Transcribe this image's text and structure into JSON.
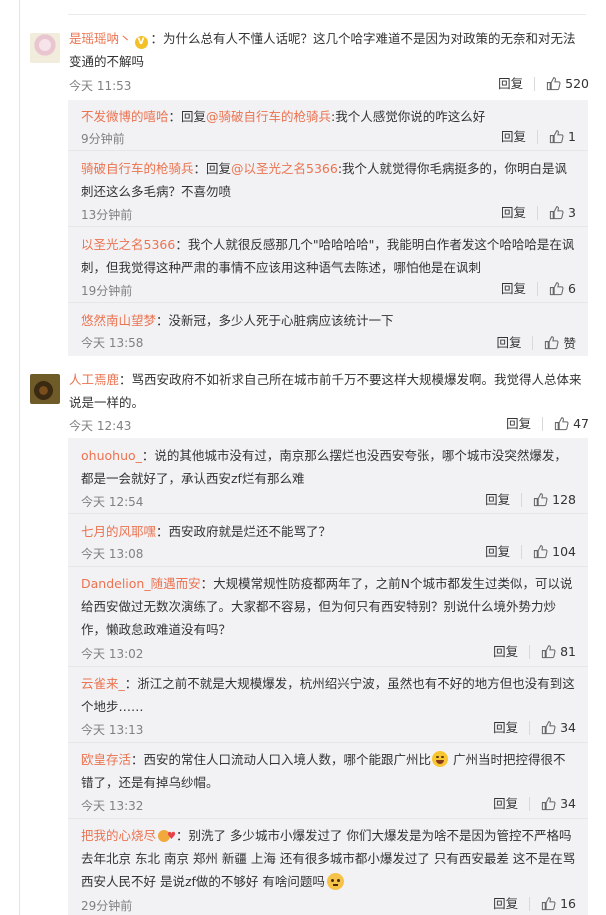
{
  "comments": [
    {
      "user": "是瑶瑶呐丶",
      "verified": "V",
      "text": "：为什么总有人不懂人话呢？这几个哈字难道不是因为对政策的无奈和对无法变通的不解吗",
      "time": "今天 11:53",
      "reply_label": "回复",
      "likes": "520",
      "replies": [
        {
          "user": "不发微博的嘻哈",
          "text_pre": "：回复",
          "at": "@骑破自行车的枪骑兵",
          "text": ":我个人感觉你说的咋这么好",
          "time": "9分钟前",
          "reply_label": "回复",
          "likes": "1"
        },
        {
          "user": "骑破自行车的枪骑兵",
          "text_pre": "：回复",
          "at": "@以圣光之名5366",
          "text": ":我个人就觉得你毛病挺多的，你明白是讽刺还这么多毛病？不喜勿喷",
          "time": "13分钟前",
          "reply_label": "回复",
          "likes": "3"
        },
        {
          "user": "以圣光之名5366",
          "text": "：我个人就很反感那几个\"哈哈哈哈\"，我能明白作者发这个哈哈哈是在讽刺，但我觉得这种严肃的事情不应该用这种语气去陈述，哪怕他是在讽刺",
          "time": "19分钟前",
          "reply_label": "回复",
          "likes": "6"
        },
        {
          "user": "悠然南山望梦",
          "text": "：没新冠，多少人死于心脏病应该统计一下",
          "time": "今天 13:58",
          "reply_label": "回复",
          "likes": "赞"
        }
      ]
    },
    {
      "user": "人工焉鹿",
      "text": "：骂西安政府不如祈求自己所在城市前千万不要这样大规模爆发啊。我觉得人总体来说是一样的。",
      "time": "今天 12:43",
      "reply_label": "回复",
      "likes": "47",
      "replies": [
        {
          "user": "ohuohuo_",
          "text": "：说的其他城市没有过，南京那么摆烂也没西安夸张，哪个城市没突然爆发，都是一会就好了，承认西安zf烂有那么难",
          "time": "今天 12:54",
          "reply_label": "回复",
          "likes": "128"
        },
        {
          "user": "七月的风耶嘿",
          "text": "：西安政府就是烂还不能骂了？",
          "time": "今天 13:08",
          "reply_label": "回复",
          "likes": "104"
        },
        {
          "user": "Dandelion_随遇而安",
          "text": "：大规模常规性防疫都两年了，之前N个城市都发生过类似，可以说给西安做过无数次演练了。大家都不容易，但为何只有西安特别？别说什么境外势力炒作，懒政怠政难道没有吗？",
          "time": "今天 13:02",
          "reply_label": "回复",
          "likes": "81"
        },
        {
          "user": "云雀来_",
          "text": "：浙江之前不就是大规模爆发，杭州绍兴宁波，虽然也有不好的地方但也没有到这个地步……",
          "time": "今天 13:13",
          "reply_label": "回复",
          "likes": "34"
        },
        {
          "user": "欧皇存活",
          "text_a": "：西安的常住人口流动人口入境人数，哪个能跟广州比",
          "text_b": " 广州当时把控得很不错了，还是有掉乌纱帽。",
          "time": "今天 13:32",
          "reply_label": "回复",
          "likes": "34"
        },
        {
          "user": "把我的心烧尽",
          "text": "：别洗了 多少城市小爆发过了 你们大爆发是为啥不是因为管控不严格吗 去年北京 东北 南京 郑州 新疆 上海 还有很多城市都小爆发过了 只有西安最差 这不是在骂西安人民不好 是说zf做的不够好 有啥问题吗",
          "time": "29分钟前",
          "reply_label": "回复",
          "likes": "16"
        }
      ]
    }
  ],
  "icons": {
    "like": "thumbs-up-icon",
    "verified": "verified-badge-icon",
    "emoji_laugh": "laugh-emoji-icon",
    "emoji_heart": "heart-emoji-icon",
    "emoji_think": "thinking-emoji-icon"
  },
  "colors": {
    "username": "#eb7350",
    "time": "#808080",
    "reply_bg": "#f2f2f5",
    "verified": "#f4c02a"
  }
}
